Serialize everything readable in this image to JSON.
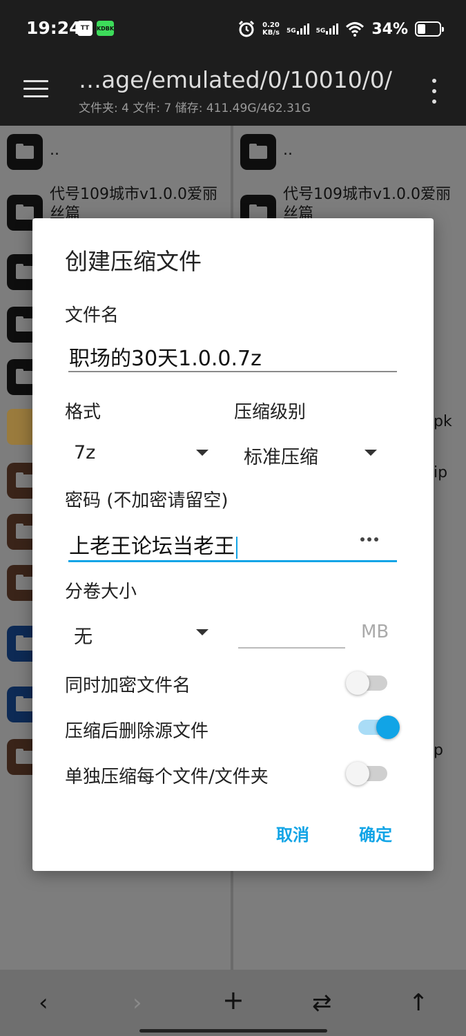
{
  "status_bar": {
    "time": "19:24",
    "app_icon_1": "TT",
    "app_icon_2": "KDBK",
    "net_speed_value": "0.20",
    "net_speed_unit": "KB/s",
    "signal_1": "5G",
    "signal_2": "5G",
    "battery_text": "34%",
    "icons": [
      "alarm-icon",
      "wifi-icon",
      "battery-icon"
    ]
  },
  "toolbar": {
    "path": "…age/emulated/0/10010/0/",
    "info": "文件夹: 4  文件: 7  储存: 411.49G/462.31G"
  },
  "left_pane": {
    "items": [
      {
        "name": ".."
      },
      {
        "name_line1": "代号109城市v1.0.0爱丽",
        "name_line2": "丝篇"
      }
    ]
  },
  "right_pane": {
    "items": [
      {
        "name": ".."
      },
      {
        "name_line1": "代号109城市v1.0.0爱丽",
        "name_line2": "丝篇"
      }
    ],
    "tail_1": "pk",
    "tail_2": "ip",
    "tail_3": "p"
  },
  "dialog": {
    "title": "创建压缩文件",
    "filename_label": "文件名",
    "filename_value": "职场的30天1.0.0.7z",
    "format_label": "格式",
    "format_value": "7z",
    "level_label": "压缩级别",
    "level_value": "标准压缩",
    "password_label": "密码 (不加密请留空)",
    "password_value": "上老王论坛当老王",
    "volume_label": "分卷大小",
    "volume_value": "无",
    "volume_unit": "MB",
    "options": [
      {
        "label": "同时加密文件名",
        "on": false
      },
      {
        "label": "压缩后删除源文件",
        "on": true
      },
      {
        "label": "单独压缩每个文件/文件夹",
        "on": false
      }
    ],
    "cancel": "取消",
    "confirm": "确定"
  },
  "bottom_bar": {
    "back": "‹",
    "forward": "›",
    "add": "+",
    "swap": "⇄",
    "up": "↑"
  },
  "colors": {
    "accent": "#11a4e6",
    "toolbar_bg": "#1d1d1d",
    "dialog_bg": "#ffffff"
  }
}
